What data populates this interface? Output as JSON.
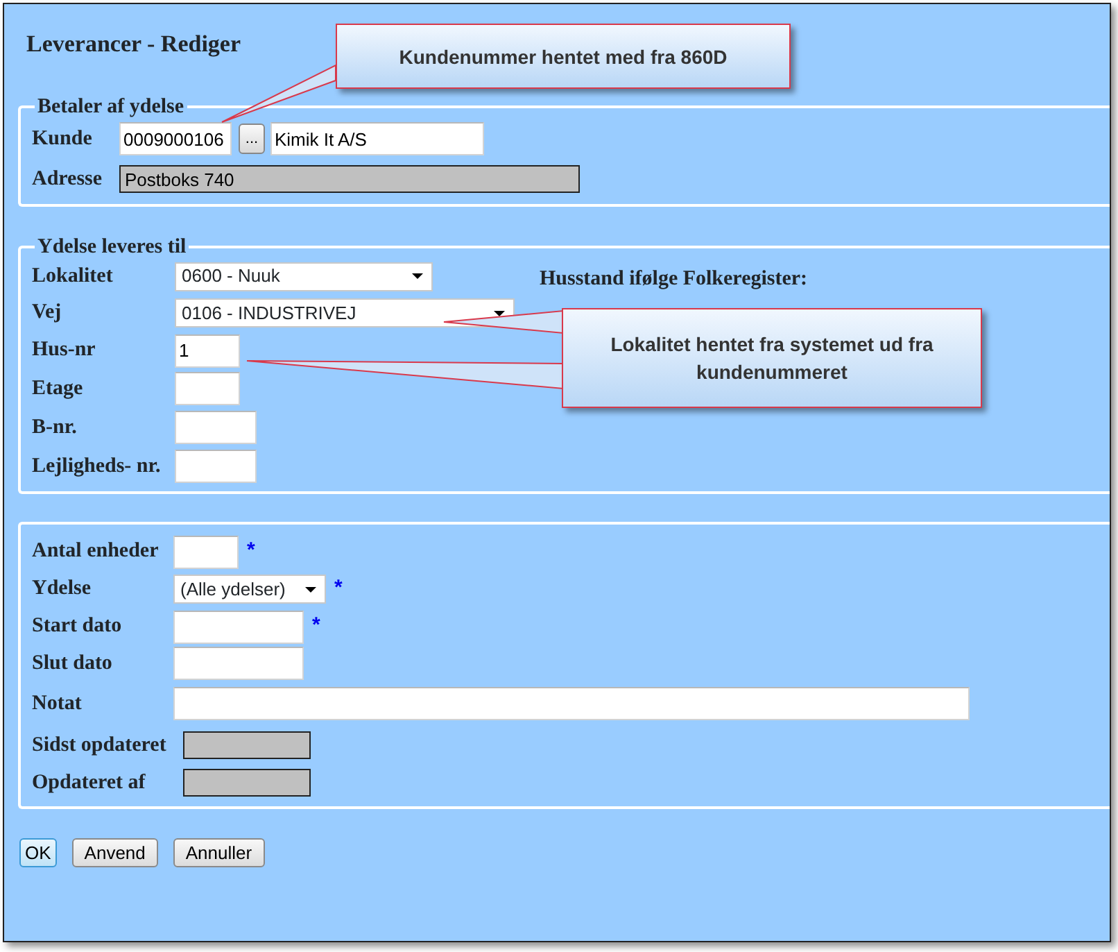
{
  "window": {
    "title": "Leverancer - Rediger"
  },
  "sections": [
    {
      "legend": "Betaler af ydelse",
      "fields": [
        {
          "kind": "lookup",
          "label": "Kunde",
          "value": "0009000106",
          "button": "...",
          "name_value": "Kimik It A/S"
        },
        {
          "kind": "readonly",
          "label": "Adresse",
          "value": "Postboks 740"
        }
      ]
    },
    {
      "legend": "Ydelse leveres til",
      "note": "Husstand ifølge Folkeregister:",
      "fields": [
        {
          "kind": "select",
          "label": "Lokalitet",
          "value": "0600 - Nuuk"
        },
        {
          "kind": "select",
          "label": "Vej",
          "value": "0106 - INDUSTRIVEJ"
        },
        {
          "kind": "text",
          "label": "Hus-nr",
          "value": "1"
        },
        {
          "kind": "text",
          "label": "Etage"
        },
        {
          "kind": "text",
          "label": "B-nr."
        },
        {
          "kind": "text",
          "label": "Lejligheds- nr."
        }
      ]
    },
    {
      "fields": [
        {
          "kind": "text",
          "label": "Antal enheder",
          "required_mark": "*"
        },
        {
          "kind": "select",
          "label": "Ydelse",
          "value": "(Alle ydelser)",
          "required_mark": "*"
        },
        {
          "kind": "text",
          "label": "Start dato",
          "required_mark": "*"
        },
        {
          "kind": "text",
          "label": "Slut dato"
        },
        {
          "kind": "text",
          "label": "Notat"
        },
        {
          "kind": "readonly",
          "label": "Sidst opdateret"
        },
        {
          "kind": "readonly",
          "label": "Opdateret af"
        }
      ]
    }
  ],
  "buttons": [
    {
      "label": "OK",
      "default": true
    },
    {
      "label": "Anvend",
      "default": false
    },
    {
      "label": "Annuller",
      "default": false
    }
  ],
  "callouts": [
    {
      "text": "Kundenummer hentet med fra 860D"
    },
    {
      "text": "Lokalitet hentet fra systemet ud fra kundenummeret"
    }
  ]
}
